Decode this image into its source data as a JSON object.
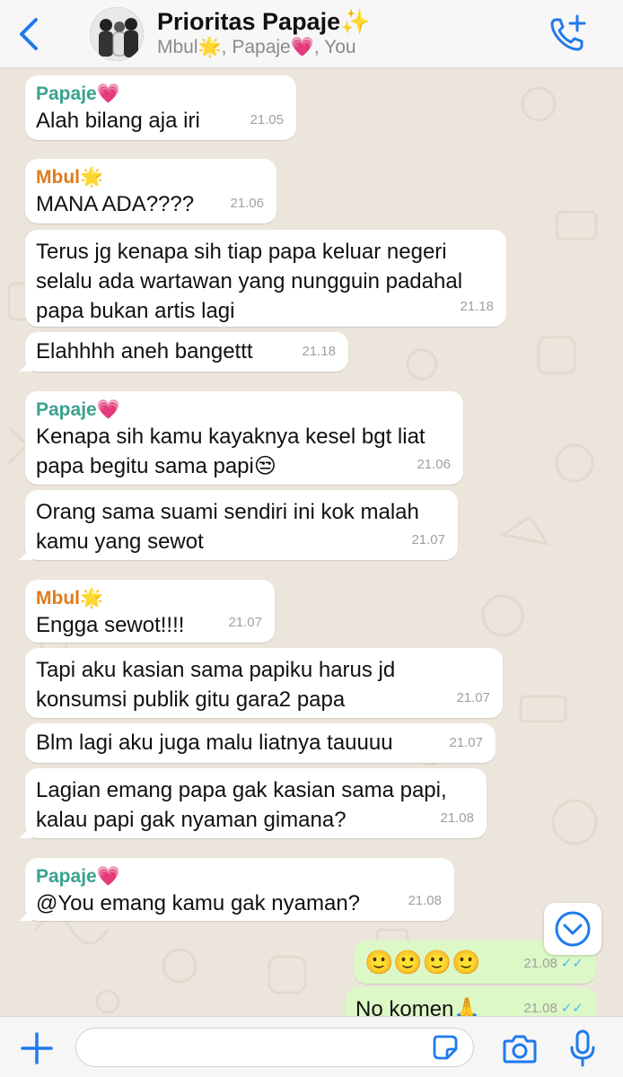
{
  "header": {
    "title": "Prioritas Papaje✨",
    "subtitle": "Mbul🌟, Papaje💗, You"
  },
  "messages": [
    {
      "sender": "Papaje💗",
      "text": "Alah bilang aja iri",
      "time": "21.05"
    },
    {
      "sender": "Mbul🌟",
      "text": "MANA ADA????",
      "time": "21.06"
    },
    {
      "sender": "",
      "text": "Terus jg kenapa sih tiap papa keluar negeri\nselalu ada wartawan yang nungguin padahal\npapa bukan artis lagi",
      "time": "21.18"
    },
    {
      "sender": "",
      "text": "Elahhhh aneh bangettt",
      "time": "21.18"
    },
    {
      "sender": "Papaje💗",
      "text": "Kenapa sih kamu kayaknya kesel bgt liat\npapa begitu sama papi😒",
      "time": "21.06"
    },
    {
      "sender": "",
      "text": "Orang sama suami sendiri ini kok malah\nkamu yang sewot",
      "time": "21.07"
    },
    {
      "sender": "Mbul🌟",
      "text": "Engga sewot!!!!",
      "time": "21.07"
    },
    {
      "sender": "",
      "text": "Tapi aku kasian sama papiku harus jd\nkonsumsi publik gitu gara2 papa",
      "time": "21.07"
    },
    {
      "sender": "",
      "text": "Blm lagi aku juga malu liatnya tauuuu",
      "time": "21.07"
    },
    {
      "sender": "",
      "text": "Lagian emang papa gak kasian sama papi,\nkalau papi gak nyaman gimana?",
      "time": "21.08"
    },
    {
      "sender": "Papaje💗",
      "text": "@You emang kamu gak nyaman?",
      "time": "21.08"
    },
    {
      "sender": "",
      "text": "🙂🙂🙂🙂",
      "time": "21.08"
    },
    {
      "sender": "",
      "text": "No komen🙏",
      "time": "21.08"
    }
  ],
  "input": {
    "placeholder": ""
  },
  "icons": {
    "back": "chevron-left-icon",
    "call": "phone-plus-icon",
    "scroll": "chevron-down-circle-icon",
    "attach": "plus-icon",
    "sticker": "sticker-icon",
    "camera": "camera-icon",
    "mic": "microphone-icon"
  },
  "colors": {
    "accent": "#1f7aec",
    "papaje": "#3aa28d",
    "mbul": "#e07b1a",
    "outgoing": "#dcf8c6",
    "read_ticks": "#4fb6ec"
  }
}
